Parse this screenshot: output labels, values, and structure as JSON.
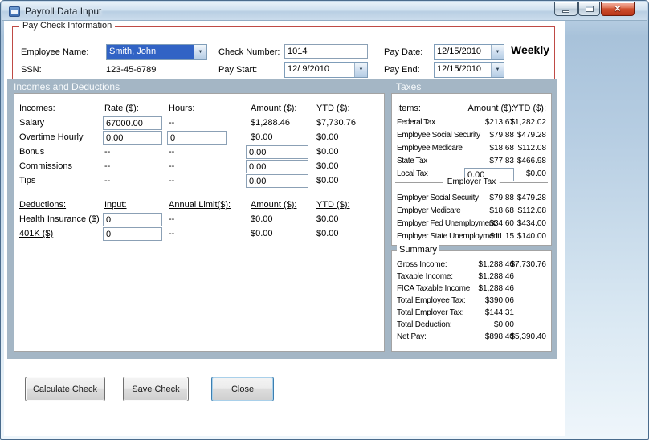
{
  "window": {
    "title": "Payroll Data Input"
  },
  "icons": {
    "dropdown_arrow": "▼",
    "close": "×"
  },
  "colors": {
    "group_border_red": "#bf4a45",
    "panel_background": "#a4b6c5",
    "selection_blue": "#3163c5",
    "close_button_red": "#cf4f2e"
  },
  "pay_check_info": {
    "group_title": "Pay Check Information",
    "employee_name": {
      "label": "Employee Name:",
      "value": "Smith, John"
    },
    "ssn": {
      "label": "SSN:",
      "value": "123-45-6789"
    },
    "check_number": {
      "label": "Check Number:",
      "value": "1014"
    },
    "pay_start": {
      "label": "Pay Start:",
      "value": "12/ 9/2010"
    },
    "pay_date": {
      "label": "Pay Date:",
      "value": "12/15/2010"
    },
    "pay_end": {
      "label": "Pay End:",
      "value": "12/15/2010"
    },
    "frequency": "Weekly"
  },
  "sections": {
    "incomes_header": "Incomes and Deductions",
    "taxes_header": "Taxes"
  },
  "incomes": {
    "headers": {
      "item": "Incomes:",
      "rate": "Rate ($):",
      "hours": "Hours:",
      "amount": "Amount ($):",
      "ytd": "YTD ($):"
    },
    "salary": {
      "label": "Salary",
      "rate": "67000.00",
      "hours": "--",
      "amount": "$1,288.46",
      "ytd": "$7,730.76"
    },
    "overtime": {
      "label": "Overtime Hourly",
      "rate": "0.00",
      "hours": "0",
      "amount": "$0.00",
      "ytd": "$0.00"
    },
    "bonus": {
      "label": "Bonus",
      "rate": "--",
      "hours": "--",
      "amount": "0.00",
      "ytd": "$0.00"
    },
    "commissions": {
      "label": "Commissions",
      "rate": "--",
      "hours": "--",
      "amount": "0.00",
      "ytd": "$0.00"
    },
    "tips": {
      "label": "Tips",
      "rate": "--",
      "hours": "--",
      "amount": "0.00",
      "ytd": "$0.00"
    }
  },
  "deductions": {
    "headers": {
      "item": "Deductions:",
      "input": "Input:",
      "limit": "Annual Limit($):",
      "amount": "Amount ($):",
      "ytd": "YTD ($):"
    },
    "health": {
      "label": "Health Insurance ($)",
      "input": "0",
      "limit": "--",
      "amount": "$0.00",
      "ytd": "$0.00"
    },
    "k401": {
      "label": "401K ($)",
      "input": "0",
      "limit": "--",
      "amount": "$0.00",
      "ytd": "$0.00"
    }
  },
  "taxes": {
    "headers": {
      "item": "Items:",
      "amount": "Amount ($):",
      "ytd": "YTD ($):"
    },
    "rows": [
      {
        "label": "Federal Tax",
        "amount": "$213.67",
        "ytd": "$1,282.02"
      },
      {
        "label": "Employee Social Security",
        "amount": "$79.88",
        "ytd": "$479.28"
      },
      {
        "label": "Employee Medicare",
        "amount": "$18.68",
        "ytd": "$112.08"
      },
      {
        "label": "State Tax",
        "amount": "$77.83",
        "ytd": "$466.98"
      }
    ],
    "local_tax": {
      "label": "Local Tax",
      "amount": "0.00",
      "ytd": "$0.00"
    },
    "employer_separator": "Employer Tax",
    "employer_rows": [
      {
        "label": "Employer Social Security",
        "amount": "$79.88",
        "ytd": "$479.28"
      },
      {
        "label": "Employer Medicare",
        "amount": "$18.68",
        "ytd": "$112.08"
      },
      {
        "label": "Employer Fed Unemployment",
        "amount": "$34.60",
        "ytd": "$434.00"
      },
      {
        "label": "Employer State Unemployment",
        "amount": "$11.15",
        "ytd": "$140.00"
      }
    ]
  },
  "summary": {
    "group_title": "Summary",
    "rows": [
      {
        "label": "Gross Income:",
        "value": "$1,288.46",
        "ytd": "$7,730.76"
      },
      {
        "label": "Taxable Income:",
        "value": "$1,288.46",
        "ytd": ""
      },
      {
        "label": "FICA Taxable Income:",
        "value": "$1,288.46",
        "ytd": ""
      },
      {
        "label": "Total Employee Tax:",
        "value": "$390.06",
        "ytd": ""
      },
      {
        "label": "Total Employer Tax:",
        "value": "$144.31",
        "ytd": ""
      },
      {
        "label": "Total Deduction:",
        "value": "$0.00",
        "ytd": ""
      },
      {
        "label": "Net Pay:",
        "value": "$898.40",
        "ytd": "$5,390.40"
      }
    ]
  },
  "buttons": {
    "calculate": "Calculate Check",
    "save": "Save Check",
    "close": "Close"
  }
}
